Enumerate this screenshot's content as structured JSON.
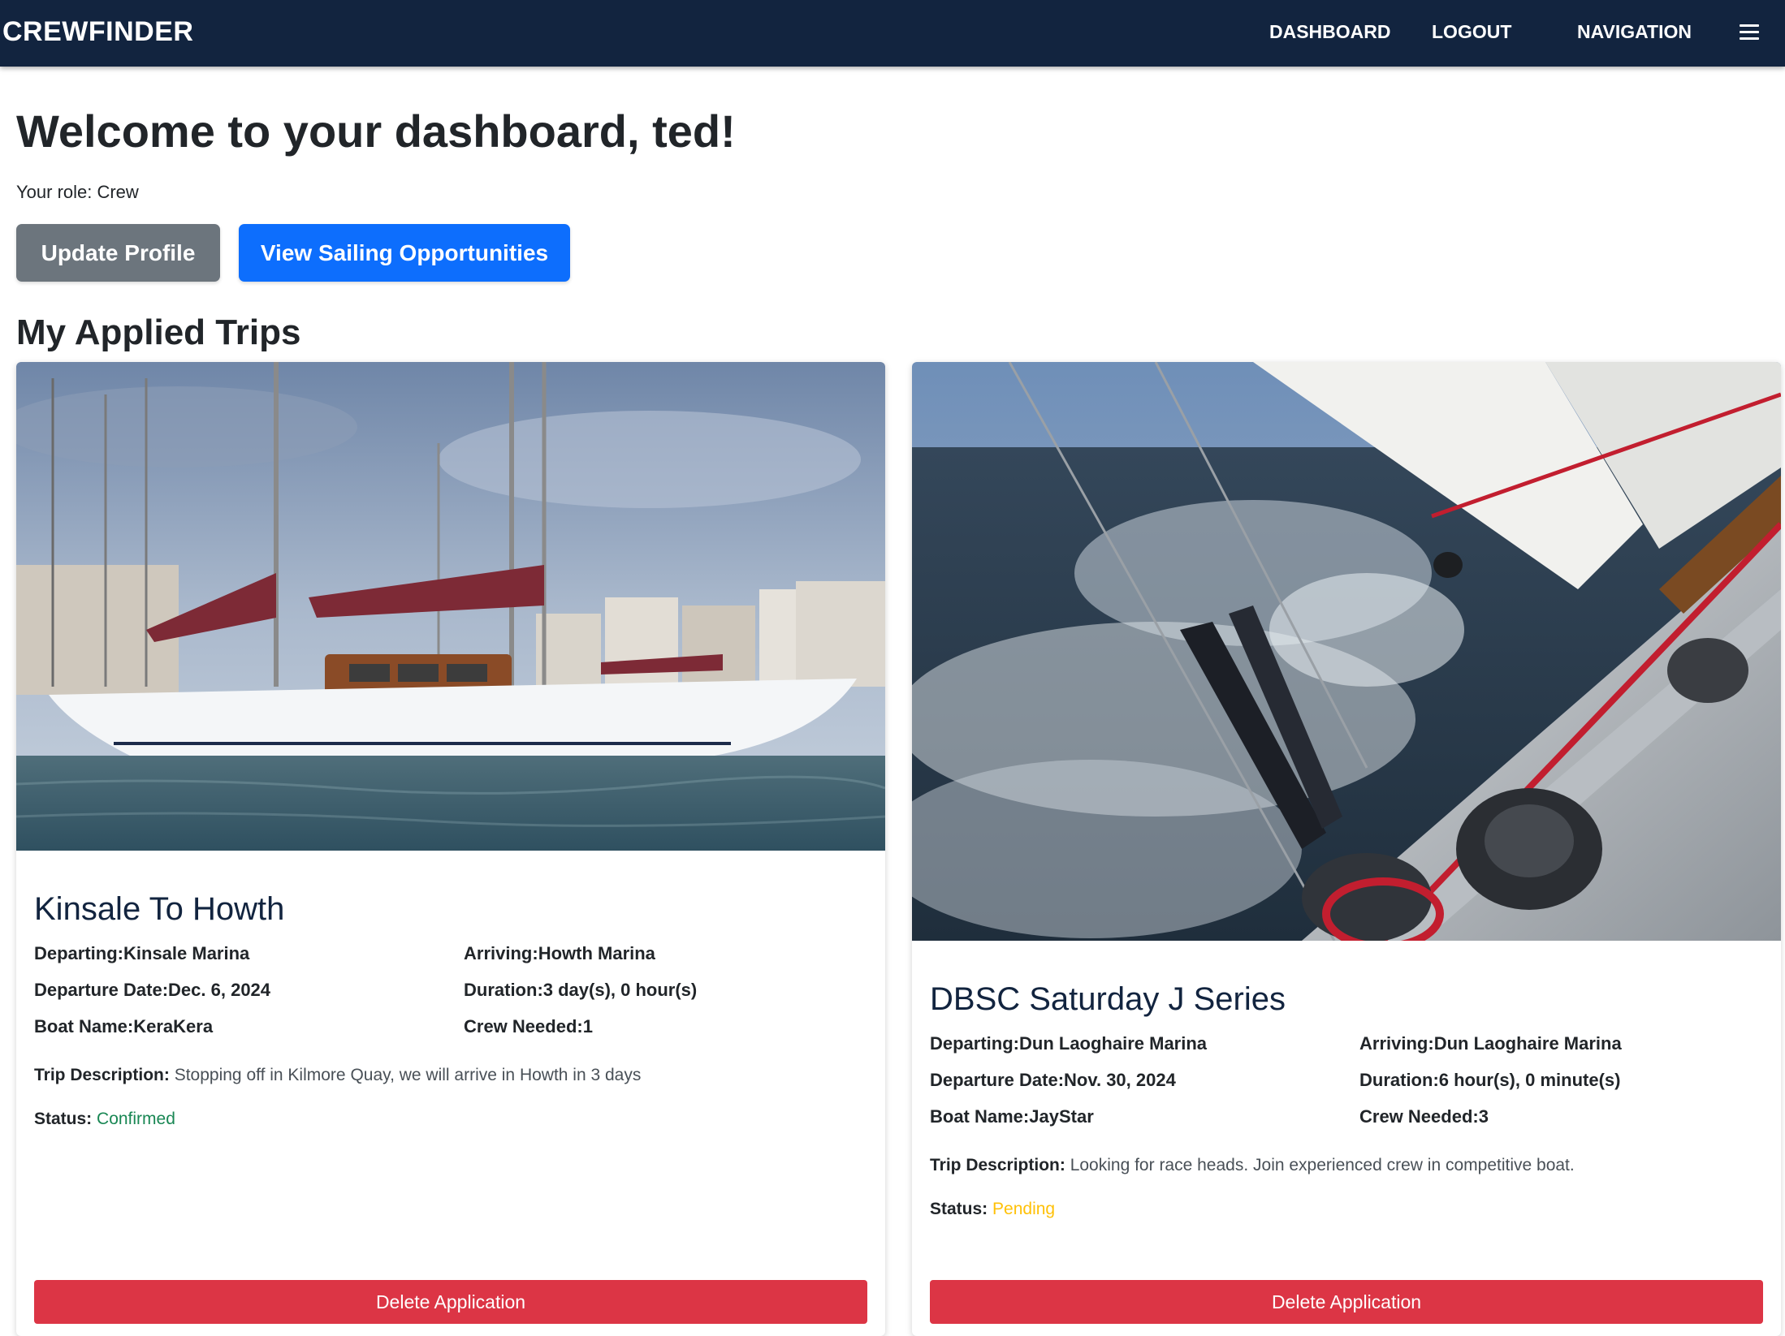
{
  "nav": {
    "brand": "CREWFINDER",
    "links": [
      "DASHBOARD",
      "LOGOUT",
      "NAVIGATION"
    ],
    "menu_icon": "hamburger-icon"
  },
  "header": {
    "title": "Welcome to your dashboard, ted!",
    "role_text": "Your role: Crew",
    "update_profile_label": "Update Profile",
    "view_opportunities_label": "View Sailing Opportunities"
  },
  "section": {
    "title": "My Applied Trips"
  },
  "trips": [
    {
      "title": "Kinsale To Howth",
      "departing_label": "Departing:",
      "departing": "Kinsale Marina",
      "arriving_label": "Arriving:",
      "arriving": "Howth Marina",
      "departure_date_label": "Departure Date:",
      "departure_date": "Dec. 6, 2024",
      "duration_label": "Duration:",
      "duration": "3 day(s), 0 hour(s)",
      "boat_name_label": "Boat Name:",
      "boat_name": "KeraKera",
      "crew_needed_label": "Crew Needed:",
      "crew_needed": "1",
      "description_label": "Trip Description:",
      "description": "Stopping off in Kilmore Quay, we will arrive in Howth in 3 days",
      "status_label": "Status:",
      "status": "Confirmed",
      "delete_label": "Delete Application",
      "image": "sailboat-moored-in-marina-photo"
    },
    {
      "title": "DBSC Saturday J Series",
      "departing_label": "Departing:",
      "departing": "Dun Laoghaire Marina",
      "arriving_label": "Arriving:",
      "arriving": "Dun Laoghaire Marina",
      "departure_date_label": "Departure Date:",
      "departure_date": "Nov. 30, 2024",
      "duration_label": "Duration:",
      "duration": "6 hour(s), 0 minute(s)",
      "boat_name_label": "Boat Name:",
      "boat_name": "JayStar",
      "crew_needed_label": "Crew Needed:",
      "crew_needed": "3",
      "description_label": "Trip Description:",
      "description": "Looking for race heads. Join experienced crew in competitive boat.",
      "status_label": "Status:",
      "status": "Pending",
      "delete_label": "Delete Application",
      "image": "racing-yacht-heeling-in-waves-photo"
    }
  ],
  "colors": {
    "navbar": "#12243f",
    "primary": "#0d6efd",
    "secondary": "#6c757d",
    "danger": "#dc3545",
    "confirmed": "#198754",
    "pending": "#ffc107"
  }
}
